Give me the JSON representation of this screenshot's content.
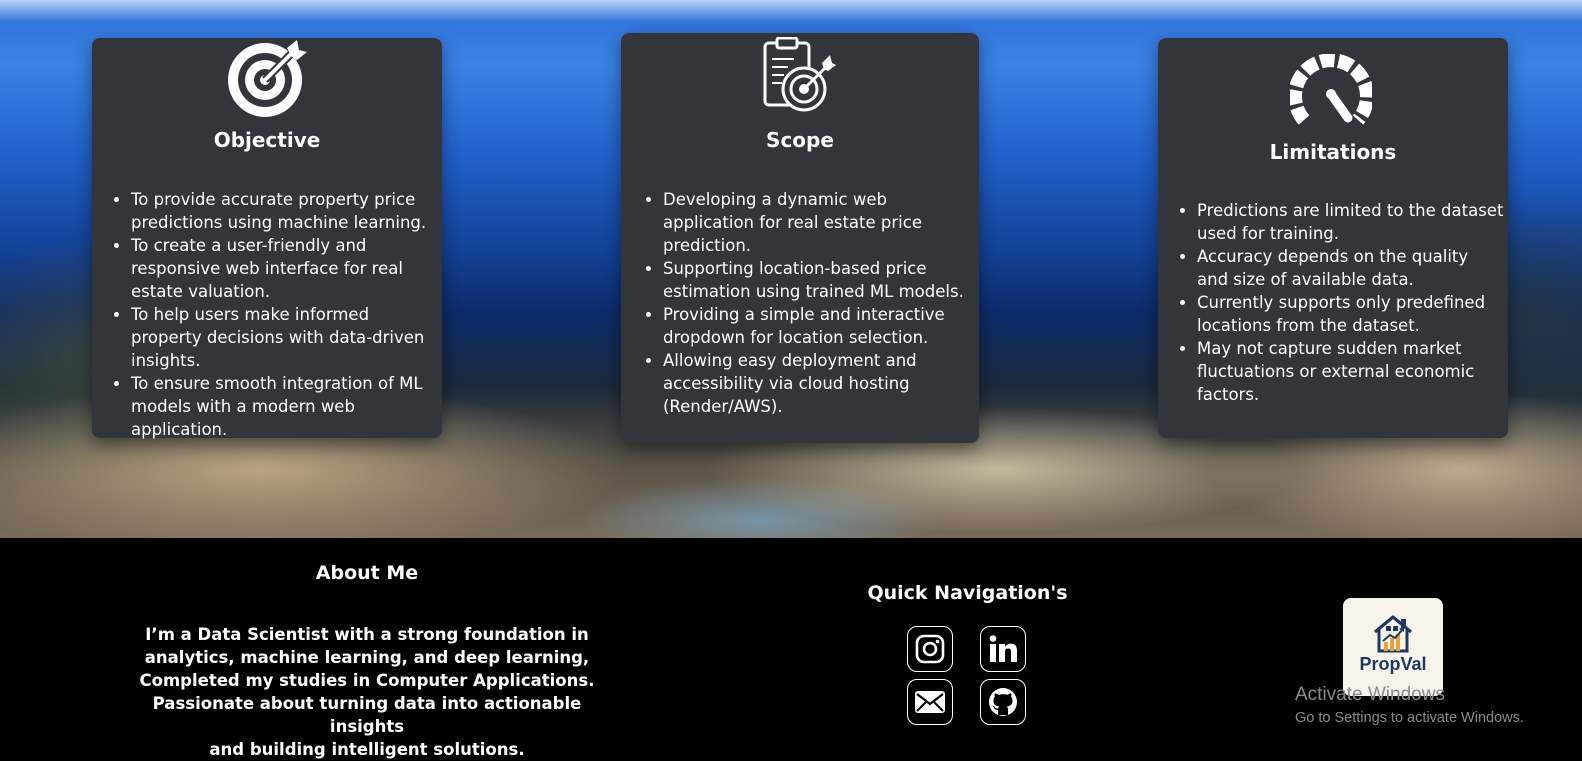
{
  "cards": {
    "objective": {
      "title": "Objective",
      "icon": "target-arrow-icon",
      "items": [
        "To provide accurate property price predictions using machine learning.",
        "To create a user-friendly and responsive web interface for real estate valuation.",
        "To help users make informed property decisions with data-driven insights.",
        "To ensure smooth integration of ML models with a modern web application."
      ]
    },
    "scope": {
      "title": "Scope",
      "icon": "clipboard-target-icon",
      "items": [
        "Developing a dynamic web application for real estate price prediction.",
        "Supporting location-based price estimation using trained ML models.",
        "Providing a simple and interactive dropdown for location selection.",
        "Allowing easy deployment and accessibility via cloud hosting (Render/AWS)."
      ]
    },
    "limitations": {
      "title": "Limitations",
      "icon": "gauge-icon",
      "items": [
        "Predictions are limited to the dataset used for training.",
        "Accuracy depends on the quality and size of available data.",
        "Currently supports only predefined locations from the dataset.",
        "May not capture sudden market fluctuations or external economic factors."
      ]
    }
  },
  "footer": {
    "about": {
      "title": "About Me",
      "lines": [
        "I’m a Data Scientist with a strong foundation in",
        "analytics, machine learning, and deep learning,",
        "Completed my studies in Computer Applications.",
        "Passionate about turning data into actionable insights",
        "and building intelligent solutions."
      ]
    },
    "navigation": {
      "title": "Quick Navigation's",
      "links": [
        {
          "name": "instagram",
          "icon": "instagram-icon"
        },
        {
          "name": "linkedin",
          "icon": "linkedin-icon"
        },
        {
          "name": "email",
          "icon": "mail-icon"
        },
        {
          "name": "github",
          "icon": "github-icon"
        }
      ]
    },
    "logo": {
      "text": "PropVal",
      "icon": "house-chart-icon"
    }
  },
  "watermark": {
    "title": "Activate Windows",
    "subtitle": "Go to Settings to activate Windows."
  }
}
